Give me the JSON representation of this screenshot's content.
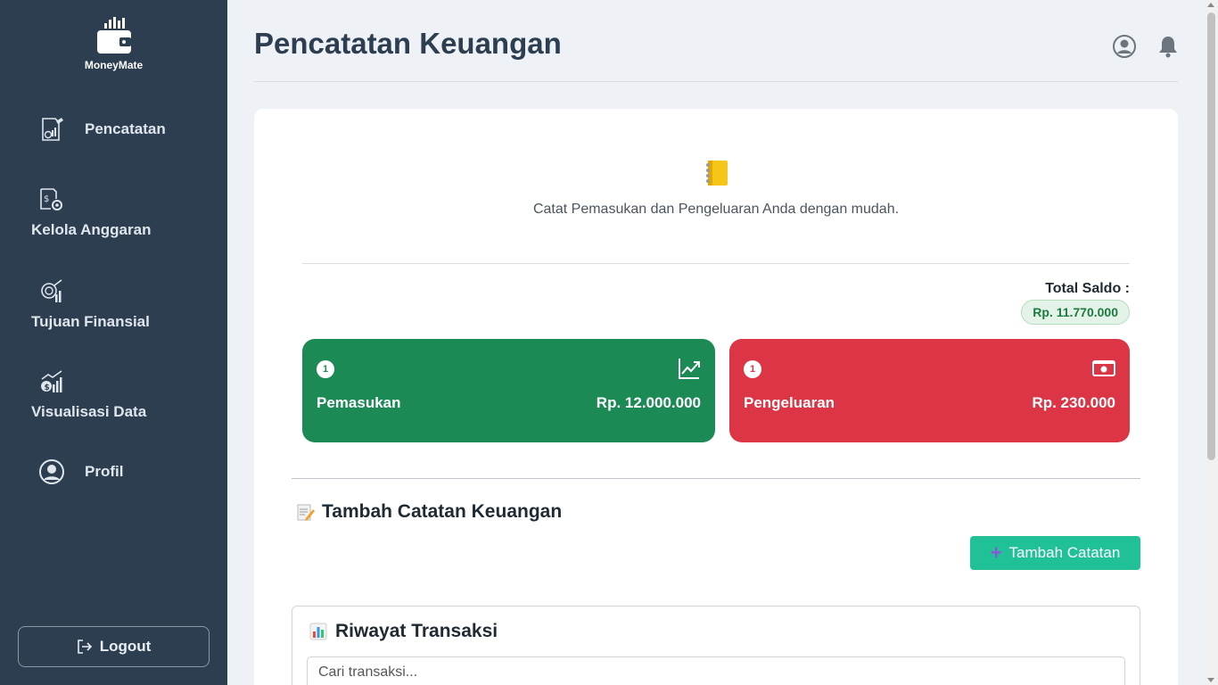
{
  "brand": {
    "name": "MoneyMate",
    "logo_icon": "wallet-icon"
  },
  "sidebar": {
    "items": [
      {
        "label": "Pencatatan",
        "icon": "receipt-chart-icon"
      },
      {
        "label": "Kelola Anggaran",
        "icon": "budget-gear-icon"
      },
      {
        "label": "Tujuan Finansial",
        "icon": "target-goal-icon"
      },
      {
        "label": "Visualisasi Data",
        "icon": "coins-chart-icon"
      },
      {
        "label": "Profil",
        "icon": "user-circle-icon"
      }
    ],
    "logout_label": "Logout"
  },
  "header": {
    "title": "Pencatatan Keuangan",
    "icons": [
      "user-circle-icon",
      "bell-icon"
    ]
  },
  "main": {
    "intro_text": "Catat Pemasukan dan Pengeluaran Anda dengan mudah.",
    "total_saldo_label": "Total Saldo :",
    "total_saldo_value": "Rp. 11.770.000",
    "income": {
      "count": "1",
      "label": "Pemasukan",
      "value": "Rp. 12.000.000",
      "icon": "trend-up-icon"
    },
    "expense": {
      "count": "1",
      "label": "Pengeluaran",
      "value": "Rp. 230.000",
      "icon": "cash-icon"
    },
    "add_section_title": "Tambah Catatan Keuangan",
    "add_button_label": "Tambah Catatan",
    "history_title": "Riwayat Transaksi",
    "search_placeholder": "Cari transaksi..."
  },
  "colors": {
    "sidebar_bg": "#2c3e50",
    "income": "#1b8a55",
    "expense": "#dc3545",
    "accent_button": "#20c197",
    "saldo_badge_bg": "#e3f3e7"
  }
}
